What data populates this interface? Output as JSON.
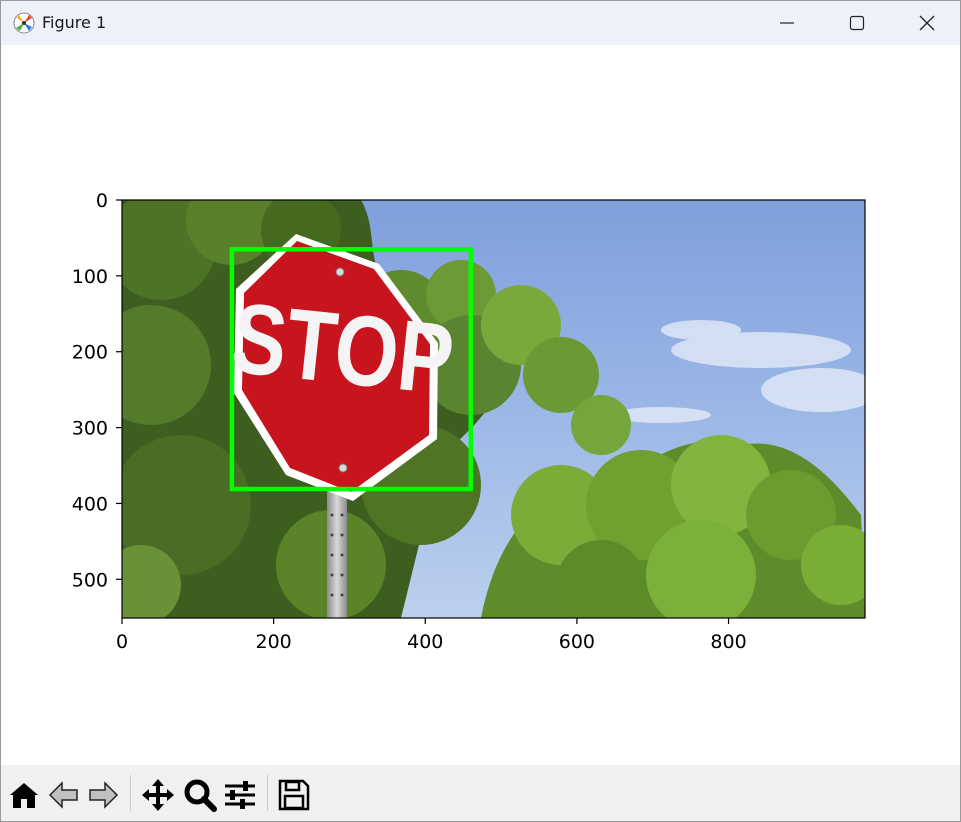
{
  "window": {
    "title": "Figure 1",
    "controls": {
      "minimize": "minimize-icon",
      "maximize": "maximize-icon",
      "close": "close-icon"
    }
  },
  "chart_data": {
    "type": "image",
    "image_width": 980,
    "image_height": 551,
    "xlim": [
      0,
      980
    ],
    "ylim": [
      551,
      0
    ],
    "x_ticks": [
      0,
      200,
      400,
      600,
      800
    ],
    "y_ticks": [
      0,
      100,
      200,
      300,
      400,
      500
    ],
    "x_tick_labels": [
      "0",
      "200",
      "400",
      "600",
      "800"
    ],
    "y_tick_labels": [
      "0",
      "100",
      "200",
      "300",
      "400",
      "500"
    ],
    "bounding_box": {
      "x0": 145,
      "y0": 65,
      "x1": 460,
      "y1": 381,
      "color": "#00ff00"
    },
    "sign_text": "STOP"
  },
  "toolbar": {
    "buttons": [
      "home-icon",
      "back-icon",
      "forward-icon",
      "pan-icon",
      "zoom-icon",
      "configure-subplots-icon",
      "save-icon"
    ]
  },
  "colors": {
    "titlebar": "#eef1f9",
    "toolbar": "#f0f0f0",
    "box": "#00ff00",
    "sign_red": "#c8141c",
    "sky": "#8aabe0"
  }
}
